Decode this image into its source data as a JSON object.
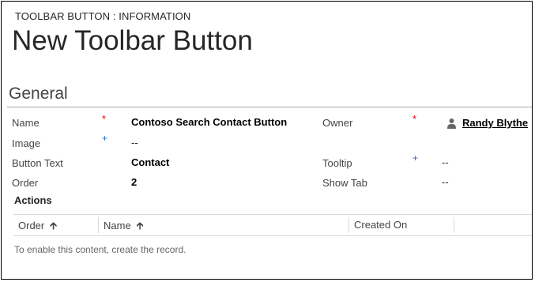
{
  "header": {
    "entity_type": "TOOLBAR BUTTON : INFORMATION",
    "title": "New Toolbar Button"
  },
  "section": {
    "title": "General"
  },
  "fields": {
    "name": {
      "label": "Name",
      "value": "Contoso Search Contact Button",
      "marker": "*"
    },
    "image": {
      "label": "Image",
      "value": "--",
      "marker": "+"
    },
    "button_text": {
      "label": "Button Text",
      "value": "Contact"
    },
    "order": {
      "label": "Order",
      "value": "2"
    },
    "owner": {
      "label": "Owner",
      "value": "Randy Blythe",
      "marker": "*",
      "icon": "person-icon"
    },
    "tooltip": {
      "label": "Tooltip",
      "value": "--",
      "marker": "+"
    },
    "show_tab": {
      "label": "Show Tab",
      "value": "--"
    }
  },
  "actions": {
    "title": "Actions",
    "columns": [
      {
        "label": "Order",
        "sort_icon": "arrow-up-icon"
      },
      {
        "label": "Name",
        "sort_icon": "arrow-up-icon"
      },
      {
        "label": "Created On"
      }
    ],
    "empty_message": "To enable this content, create the record."
  },
  "colors": {
    "required_marker": "#e00000",
    "recommended_marker": "#2266cc"
  }
}
